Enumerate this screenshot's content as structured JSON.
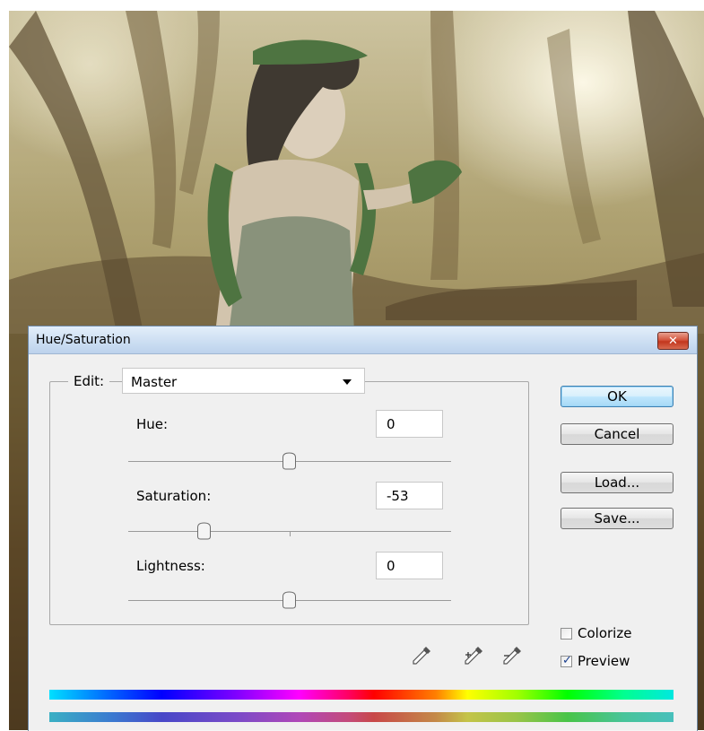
{
  "dialog": {
    "title": "Hue/Saturation",
    "close_glyph": "✕"
  },
  "edit": {
    "label": "Edit:",
    "selected": "Master"
  },
  "hue": {
    "label": "Hue:",
    "value": "0",
    "slider_fraction": 0.5
  },
  "saturation": {
    "label": "Saturation:",
    "value": "-53",
    "slider_fraction": 0.235
  },
  "lightness": {
    "label": "Lightness:",
    "value": "0",
    "slider_fraction": 0.5
  },
  "buttons": {
    "ok": "OK",
    "cancel": "Cancel",
    "load": "Load...",
    "save": "Save..."
  },
  "checkboxes": {
    "colorize": {
      "label": "Colorize",
      "checked": false
    },
    "preview": {
      "label": "Preview",
      "checked": true
    }
  },
  "icons": [
    "eyedropper-icon",
    "eyedropper-plus-icon",
    "eyedropper-minus-icon"
  ],
  "colors": {
    "title_bar": "#cfe0f3",
    "close_button": "#c2361d",
    "dialog_bg": "#f0f0f0",
    "default_button": "#bee6fd"
  }
}
